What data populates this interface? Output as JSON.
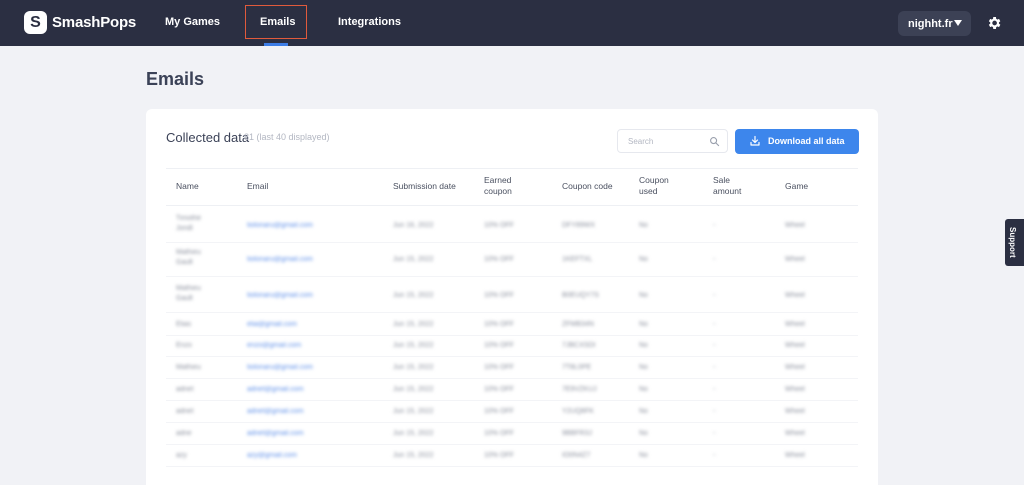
{
  "app": {
    "logo_letter": "S",
    "name": "SmashPops"
  },
  "nav": {
    "items": [
      {
        "label": "My Games"
      },
      {
        "label": "Emails"
      },
      {
        "label": "Integrations"
      }
    ],
    "active": "Emails",
    "site": "nighht.fr",
    "settings_icon": "gear-icon"
  },
  "page": {
    "title": "Emails"
  },
  "collected": {
    "title": "Collected data",
    "subtitle": "81 (last 40 displayed)",
    "search_placeholder": "Search",
    "download_label": "Download all data"
  },
  "table": {
    "headers": {
      "name": "Name",
      "email": "Email",
      "submission": "Submission date",
      "earned": "Earned coupon",
      "coupon": "Coupon code",
      "used": "Coupon used",
      "sale": "Sale amount",
      "game": "Game"
    },
    "rows": [
      {
        "name": "Timothé Jondi",
        "email": "tiolonaru@gmail.com",
        "date": "Jun 16, 2022",
        "earned": "10% OFF",
        "code": "DFY89WX",
        "used": "No",
        "sale": "-",
        "game": "Wheel"
      },
      {
        "name": "Mathieu Gault",
        "email": "tiolonaru@gmail.com",
        "date": "Jun 15, 2022",
        "earned": "10% OFF",
        "code": "1KEFTXL",
        "used": "No",
        "sale": "-",
        "game": "Wheel"
      },
      {
        "name": "Mathieu Gault",
        "email": "tiolonaru@gmail.com",
        "date": "Jun 15, 2022",
        "earned": "10% OFF",
        "code": "B0EUQY7S",
        "used": "No",
        "sale": "-",
        "game": "Wheel"
      },
      {
        "name": "Elias",
        "email": "elia@gmail.com",
        "date": "Jun 15, 2022",
        "earned": "10% OFF",
        "code": "ZFMB34N",
        "used": "No",
        "sale": "-",
        "game": "Wheel"
      },
      {
        "name": "Enzo",
        "email": "enzo@gmail.com",
        "date": "Jun 15, 2022",
        "earned": "10% OFF",
        "code": "7JBCXSDI",
        "used": "No",
        "sale": "-",
        "game": "Wheel"
      },
      {
        "name": "Mathieu",
        "email": "tiolonaru@gmail.com",
        "date": "Jun 15, 2022",
        "earned": "10% OFF",
        "code": "7T8L0PE",
        "used": "No",
        "sale": "-",
        "game": "Wheel"
      },
      {
        "name": "adnet",
        "email": "adnet@gmail.com",
        "date": "Jun 15, 2022",
        "earned": "10% OFF",
        "code": "7E9VZKUJ",
        "used": "No",
        "sale": "-",
        "game": "Wheel"
      },
      {
        "name": "adnet",
        "email": "adnet@gmail.com",
        "date": "Jun 15, 2022",
        "earned": "10% OFF",
        "code": "Y2UQ8FK",
        "used": "No",
        "sale": "-",
        "game": "Wheel"
      },
      {
        "name": "adne",
        "email": "adnet@gmail.com",
        "date": "Jun 15, 2022",
        "earned": "10% OFF",
        "code": "9BBFR3J",
        "used": "No",
        "sale": "-",
        "game": "Wheel"
      },
      {
        "name": "azy",
        "email": "azy@gmail.com",
        "date": "Jun 15, 2022",
        "earned": "10% OFF",
        "code": "IO0N4Z7",
        "used": "No",
        "sale": "-",
        "game": "Wheel"
      }
    ]
  },
  "support": {
    "label": "Support"
  },
  "colors": {
    "topbar": "#2b2f42",
    "accent": "#3d86ec",
    "highlight": "#e05a3c",
    "background": "#f1f2f6"
  }
}
